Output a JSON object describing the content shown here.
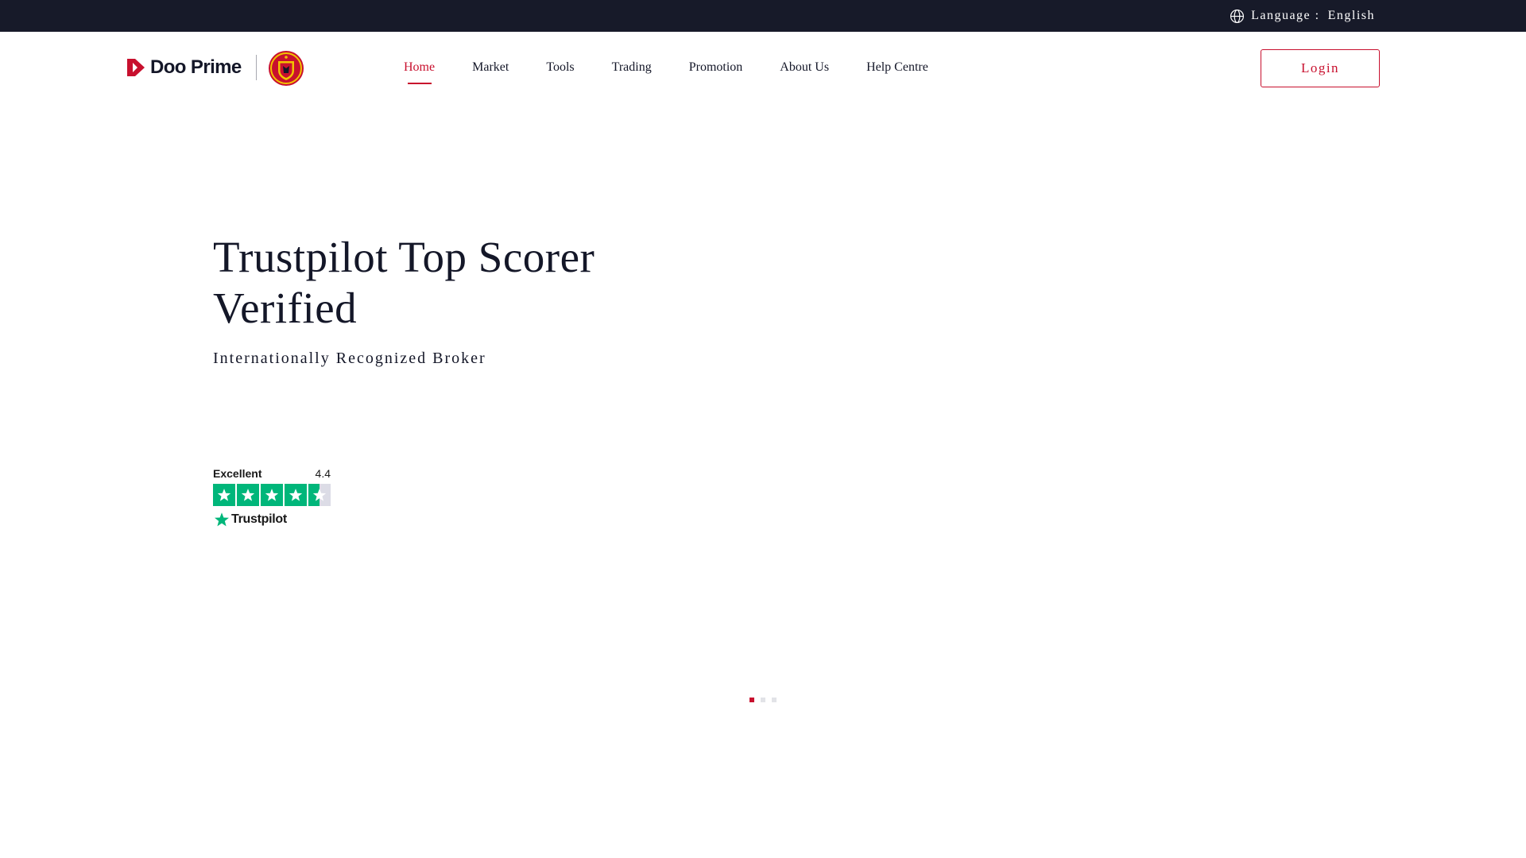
{
  "topbar": {
    "language_label": "Language :",
    "language_value": "English",
    "icon": "globe-icon"
  },
  "header": {
    "logo_text": "Doo Prime",
    "logo_icon": "doo-prime-logo-icon",
    "partner_crest": "club-crest-icon",
    "nav": [
      {
        "label": "Home",
        "active": true
      },
      {
        "label": "Market",
        "active": false
      },
      {
        "label": "Tools",
        "active": false
      },
      {
        "label": "Trading",
        "active": false
      },
      {
        "label": "Promotion",
        "active": false
      },
      {
        "label": "About Us",
        "active": false
      },
      {
        "label": "Help Centre",
        "active": false
      }
    ],
    "login_label": "Login"
  },
  "hero": {
    "title_line1": "Trustpilot Top Scorer",
    "title_line2": "Verified",
    "subtitle": "Internationally Recognized Broker"
  },
  "trustpilot": {
    "rating_label": "Excellent",
    "score": "4.4",
    "stars_filled": 4.5,
    "stars_total": 5,
    "brand": "Trustpilot",
    "star_color": "#00b67a"
  },
  "carousel": {
    "slide_count": 3,
    "active_index": 0
  },
  "colors": {
    "accent": "#c8102e",
    "topbar_bg": "#171a29",
    "text": "#141728"
  }
}
